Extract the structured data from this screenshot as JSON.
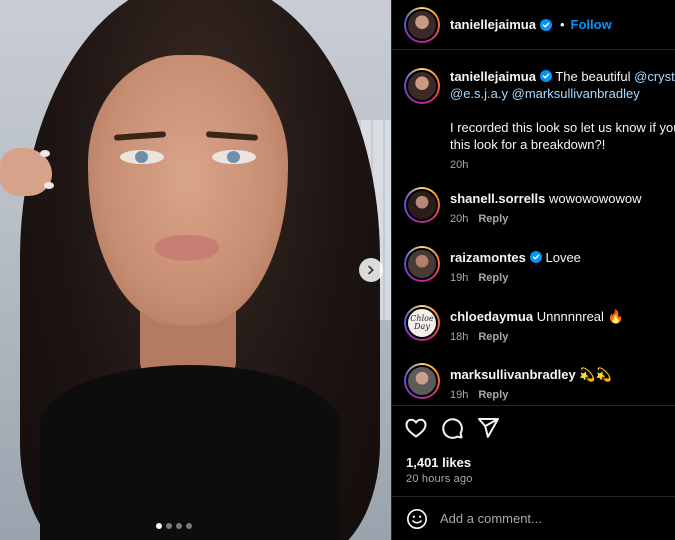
{
  "post": {
    "image_alt": "Portrait photo of a woman with long dark hair",
    "carousel": {
      "count": 4,
      "active_index": 0
    }
  },
  "header": {
    "username": "taniellejaimua",
    "separator": "•",
    "follow_label": "Follow"
  },
  "caption": {
    "username": "taniellejaimua",
    "text_before": " The beautiful ",
    "mention_1": "@crysta",
    "mention_2": "@e.s.j.a.y",
    "mention_3": "@marksullivanbradley",
    "paragraph_2": "I recorded this look so let us know if you",
    "paragraph_2b": "this look for a breakdown?!",
    "time": "20h"
  },
  "comments": [
    {
      "username": "shanell.sorrells",
      "text": " wowowowowow",
      "time": "20h",
      "reply": "Reply",
      "verified": false
    },
    {
      "username": "raizamontes",
      "text": " Lovee",
      "time": "19h",
      "reply": "Reply",
      "verified": true
    },
    {
      "username": "chloedaymua",
      "text": " Unnnnnreal 🔥",
      "time": "18h",
      "reply": "Reply",
      "verified": false
    },
    {
      "username": "marksullivanbradley",
      "text": " 💫💫",
      "time": "19h",
      "reply": "Reply",
      "verified": false
    }
  ],
  "chloe_logo": {
    "line1": "Chloe",
    "line2": "Day"
  },
  "likes": "1,401 likes",
  "posted_ago": "20 hours ago",
  "add_comment": {
    "placeholder": "Add a comment..."
  },
  "colors": {
    "accent": "#0095f6",
    "verified": "#0095f6",
    "background": "#000000",
    "muted": "#a8a8a8"
  }
}
